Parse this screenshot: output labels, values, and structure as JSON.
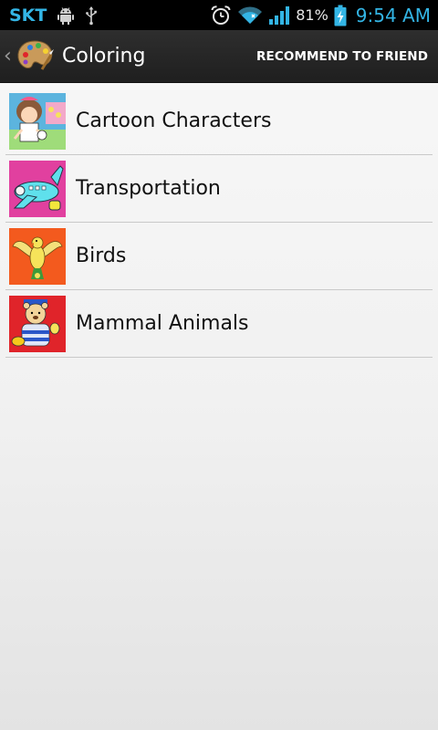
{
  "status_bar": {
    "carrier": "SKT",
    "battery_percent": "81%",
    "time": "9:54 AM",
    "icons": [
      "android-debug-icon",
      "usb-icon",
      "alarm-icon",
      "wifi-icon",
      "signal-icon",
      "battery-charging-icon"
    ]
  },
  "action_bar": {
    "title": "Coloring",
    "recommend_label": "RECOMMEND TO FRIEND",
    "app_icon": "palette-icon"
  },
  "categories": [
    {
      "label": "Cartoon Characters",
      "thumb_bg": "#5cb4de",
      "icon": "cartoon-girl-thumbnail"
    },
    {
      "label": "Transportation",
      "thumb_bg": "#e1409f",
      "icon": "airplane-thumbnail"
    },
    {
      "label": "Birds",
      "thumb_bg": "#f35a1e",
      "icon": "bird-thumbnail"
    },
    {
      "label": "Mammal Animals",
      "thumb_bg": "#e0242a",
      "icon": "bear-thumbnail"
    }
  ],
  "colors": {
    "status_accent": "#33b5e5",
    "action_bar": "#262626",
    "divider": "#c9c9c9"
  }
}
